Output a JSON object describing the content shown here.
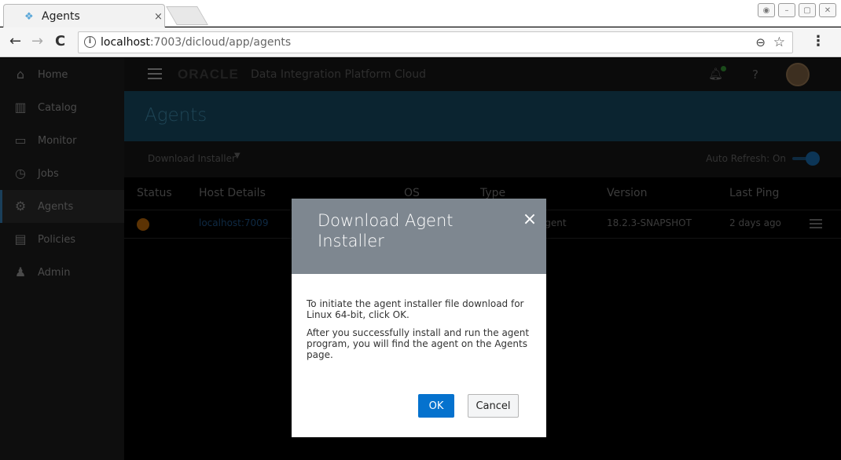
{
  "browser": {
    "tab_title": "Agents",
    "tab_close": "×",
    "url_host": "localhost",
    "url_path": ":7003/dicloud/app/agents",
    "back_icon": "←",
    "forward_icon": "→",
    "reload_icon": "C",
    "info_icon": "i",
    "zoom_icon": "⊖",
    "star_icon": "☆",
    "menu_icon": "⋮"
  },
  "sidebar": {
    "items": [
      {
        "label": "Home",
        "icon": "home-icon",
        "glyph": "⌂"
      },
      {
        "label": "Catalog",
        "icon": "catalog-icon",
        "glyph": "▥"
      },
      {
        "label": "Monitor",
        "icon": "monitor-icon",
        "glyph": "▭"
      },
      {
        "label": "Jobs",
        "icon": "jobs-icon",
        "glyph": "◷"
      },
      {
        "label": "Agents",
        "icon": "gear-icon",
        "glyph": "⚙"
      },
      {
        "label": "Policies",
        "icon": "policies-icon",
        "glyph": "▤"
      },
      {
        "label": "Admin",
        "icon": "admin-icon",
        "glyph": "♟"
      }
    ]
  },
  "header": {
    "logo": "ORACLE",
    "product": "Data Integration Platform Cloud",
    "help": "?"
  },
  "page": {
    "title": "Agents",
    "download_installer": "Download Installer",
    "auto_refresh": "Auto Refresh: On"
  },
  "table": {
    "headers": [
      "Status",
      "Host Details",
      "OS",
      "Type",
      "Version",
      "Last Ping"
    ],
    "rows": [
      {
        "host": "localhost:7009",
        "type": "Agent",
        "version": "18.2.3-SNAPSHOT",
        "last_ping": "2 days ago"
      }
    ]
  },
  "modal": {
    "title": "Download Agent Installer",
    "close": "×",
    "paragraph1": "To initiate the agent installer file download for Linux 64-bit, click OK.",
    "paragraph2": "After you successfully install and run the agent program, you will find the agent on the Agents page.",
    "ok_label": "OK",
    "cancel_label": "Cancel"
  },
  "colors": {
    "modal_header": "#7e8790",
    "primary_button": "#0572ce",
    "banner": "#0b2430"
  }
}
